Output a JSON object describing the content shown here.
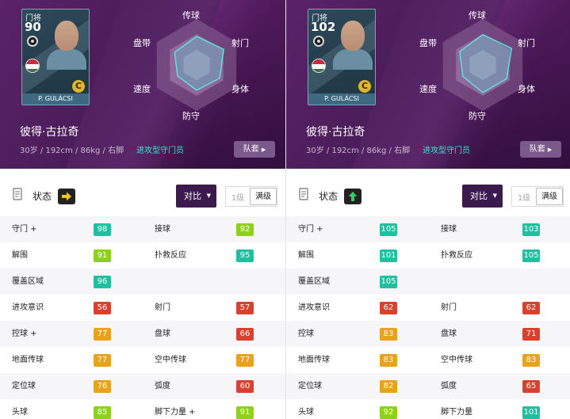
{
  "colors": {
    "green_bright": "#8ed11c",
    "green_mid": "#5cc25c",
    "teal": "#1fbfa0",
    "orange": "#e8a21c",
    "red": "#d9412f",
    "hero_purple": "#4b1d5a",
    "style_teal": "#3ee0c8"
  },
  "left": {
    "card": {
      "position": "门将",
      "overall": "90",
      "name": "P. GULÁCSI",
      "type_badge": "C",
      "flag": "hungary-flag-icon",
      "emblem": "club-emblem-icon"
    },
    "radar": {
      "labels": {
        "top": "传球",
        "top_right": "射门",
        "bottom_right": "身体",
        "bottom": "防守",
        "bottom_left": "速度",
        "top_left": "盘带"
      },
      "levels": [
        0.62,
        0.68,
        0.58,
        0.55,
        0.48,
        0.55
      ]
    },
    "player": {
      "name": "彼得·古拉奇",
      "info": "30岁 / 192cm / 86kg / 右脚",
      "style": "进攻型守门员"
    },
    "squad_button": "队套",
    "condition": {
      "label": "状态",
      "arrow": "right-arrow-icon",
      "badge_color": "#222222",
      "arrow_color": "#f5c518"
    },
    "compare_button": "对比",
    "level_min": "1级",
    "level_max": "满级",
    "stats": [
      [
        {
          "name": "守门 +",
          "value": "98",
          "color": "#1fbfa0"
        },
        {
          "name": "接球",
          "value": "92",
          "color": "#8ed11c"
        }
      ],
      [
        {
          "name": "解围",
          "value": "91",
          "color": "#8ed11c"
        },
        {
          "name": "扑救反应",
          "value": "95",
          "color": "#1fbfa0"
        }
      ],
      [
        {
          "name": "覆盖区域",
          "value": "96",
          "color": "#1fbfa0"
        },
        {
          "name": "",
          "value": "",
          "color": ""
        }
      ],
      [
        {
          "name": "进攻意识",
          "value": "56",
          "color": "#d9412f"
        },
        {
          "name": "射门",
          "value": "57",
          "color": "#d9412f"
        }
      ],
      [
        {
          "name": "控球 +",
          "value": "77",
          "color": "#e8a21c"
        },
        {
          "name": "盘球",
          "value": "66",
          "color": "#d9412f"
        }
      ],
      [
        {
          "name": "地面传球",
          "value": "77",
          "color": "#e8a21c"
        },
        {
          "name": "空中传球",
          "value": "77",
          "color": "#e8a21c"
        }
      ],
      [
        {
          "name": "定位球",
          "value": "76",
          "color": "#e8a21c"
        },
        {
          "name": "弧度",
          "value": "60",
          "color": "#d9412f"
        }
      ],
      [
        {
          "name": "头球",
          "value": "85",
          "color": "#8ed11c"
        },
        {
          "name": "脚下力量 +",
          "value": "91",
          "color": "#8ed11c"
        }
      ]
    ]
  },
  "right": {
    "card": {
      "position": "门将",
      "overall": "102",
      "name": "P. GULÁCSI",
      "type_badge": "C",
      "flag": "hungary-flag-icon",
      "emblem": "club-emblem-icon"
    },
    "radar": {
      "labels": {
        "top": "传球",
        "top_right": "射门",
        "bottom_right": "身体",
        "bottom": "防守",
        "bottom_left": "速度",
        "top_left": "盘带"
      },
      "levels": [
        0.66,
        0.72,
        0.6,
        0.6,
        0.5,
        0.58
      ]
    },
    "player": {
      "name": "彼得·古拉奇",
      "info": "30岁 / 192cm / 86kg / 右脚",
      "style": "进攻型守门员"
    },
    "squad_button": "队套",
    "condition": {
      "label": "状态",
      "arrow": "up-arrow-icon",
      "badge_color": "#222222",
      "arrow_color": "#2fd06a"
    },
    "compare_button": "对比",
    "level_min": "1级",
    "level_max": "满级",
    "stats": [
      [
        {
          "name": "守门 +",
          "value": "105",
          "color": "#1fbfa0"
        },
        {
          "name": "接球",
          "value": "103",
          "color": "#1fbfa0"
        }
      ],
      [
        {
          "name": "解围",
          "value": "101",
          "color": "#1fbfa0"
        },
        {
          "name": "扑救反应",
          "value": "105",
          "color": "#1fbfa0"
        }
      ],
      [
        {
          "name": "覆盖区域",
          "value": "105",
          "color": "#1fbfa0"
        },
        {
          "name": "",
          "value": "",
          "color": ""
        }
      ],
      [
        {
          "name": "进攻意识",
          "value": "62",
          "color": "#d9412f"
        },
        {
          "name": "射门",
          "value": "62",
          "color": "#d9412f"
        }
      ],
      [
        {
          "name": "控球",
          "value": "83",
          "color": "#e8a21c"
        },
        {
          "name": "盘球",
          "value": "71",
          "color": "#d9412f"
        }
      ],
      [
        {
          "name": "地面传球",
          "value": "83",
          "color": "#e8a21c"
        },
        {
          "name": "空中传球",
          "value": "83",
          "color": "#e8a21c"
        }
      ],
      [
        {
          "name": "定位球",
          "value": "82",
          "color": "#e8a21c"
        },
        {
          "name": "弧度",
          "value": "65",
          "color": "#d9412f"
        }
      ],
      [
        {
          "name": "头球",
          "value": "92",
          "color": "#8ed11c"
        },
        {
          "name": "脚下力量",
          "value": "101",
          "color": "#1fbfa0"
        }
      ]
    ]
  }
}
